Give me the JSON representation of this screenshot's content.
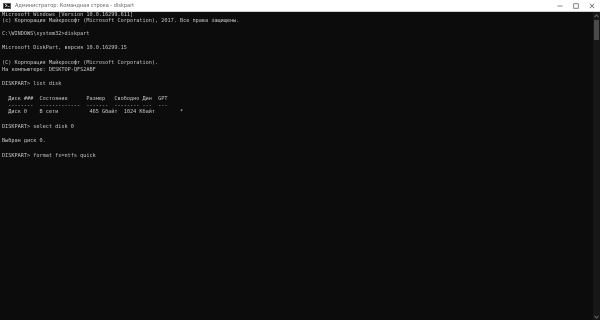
{
  "window": {
    "title": "Администратор: Командная строка - diskpart",
    "icon": "console-icon",
    "controls": [
      "minimize-icon",
      "maximize-icon",
      "close-icon"
    ]
  },
  "console": {
    "lines": [
      "Microsoft Windows [Version 10.0.16299.611]",
      "(c) Корпорация Майкрософт (Microsoft Corporation), 2017. Все права защищены.",
      "",
      "C:\\WINDOWS\\system32>diskpart",
      "",
      "Microsoft DiskPart, версия 10.0.16299.15",
      "",
      "(C) Корпорация Майкрософт (Microsoft Corporation).",
      "На компьютере: DESKTOP-QFS2ABF",
      "",
      "DISKPART> list disk",
      "",
      "  Диск ###  Состояние      Размер   Свободно Дин  GPT",
      "  --------  -------------  -------  -------- ---  ---",
      "  Диск 0    В сети          465 Gбайт  1024 Kбайт        *",
      "",
      "DISKPART> select disk 0",
      "",
      "Выбран диск 0.",
      "",
      "DISKPART> format fs=ntfs quick"
    ]
  },
  "colors": {
    "console_bg": "#0c0c0c",
    "console_text": "#c8c8c8",
    "titlebar_bg": "#ffffff"
  }
}
